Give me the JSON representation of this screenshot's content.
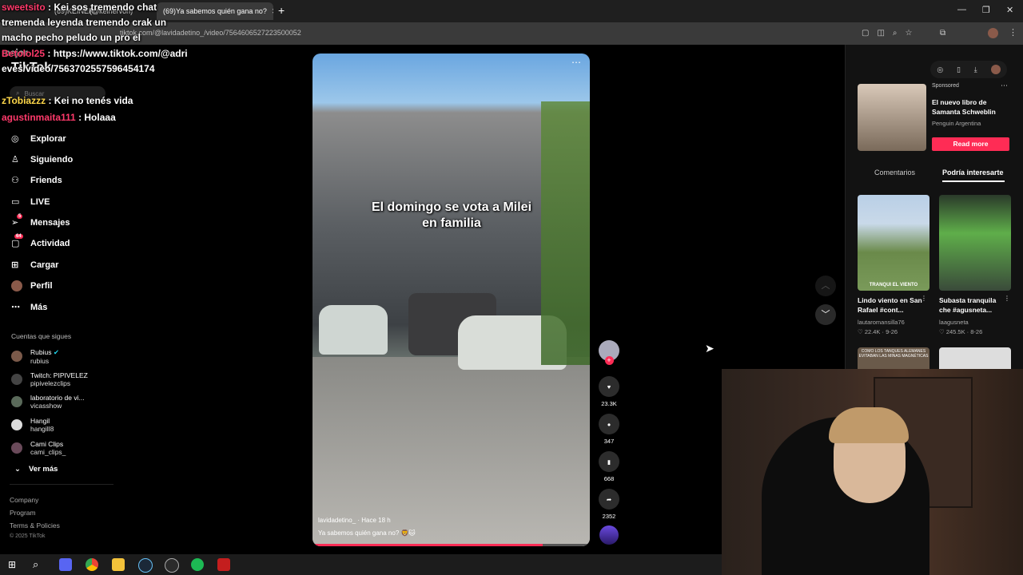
{
  "browser": {
    "tabs": [
      {
        "label": "(69)KEINER"
      },
      {
        "label": "(@keinervon)"
      },
      {
        "label": "(69)Ya sabemos quién gana no?",
        "active": true
      }
    ],
    "url": "tiktok.com/@lavidadetino_/video/7564606527223500052"
  },
  "chat": [
    {
      "user": "sweetsito",
      "msg": ": Kei sos tremendo chat tremenda leyenda tremendo crak un macho pecho peludo un pro el mejor"
    },
    {
      "user": "Betolol25",
      "msg": ": https://www.tiktok.com/@adrieves/video/7563702557596454174"
    },
    {
      "user": "zTobiazzz",
      "msg": ": Kei no tenés vida"
    },
    {
      "user": "agustinmaita111",
      "msg": ": Holaaa"
    }
  ],
  "nav": {
    "search_placeholder": "Buscar",
    "logo": "TikTok",
    "items": [
      {
        "label": "Explorar",
        "icon": "compass-icon"
      },
      {
        "label": "Siguiendo",
        "icon": "following-icon"
      },
      {
        "label": "Friends",
        "icon": "friends-icon"
      },
      {
        "label": "LIVE",
        "icon": "live-icon"
      },
      {
        "label": "Mensajes",
        "icon": "messages-icon",
        "badge": "5"
      },
      {
        "label": "Actividad",
        "icon": "activity-icon",
        "badge": "64"
      },
      {
        "label": "Cargar",
        "icon": "upload-icon"
      },
      {
        "label": "Perfil",
        "icon": "profile-icon"
      },
      {
        "label": "Más",
        "icon": "more-icon"
      }
    ],
    "following_title": "Cuentas que sigues",
    "following": [
      {
        "name": "Rubius",
        "handle": "rubius",
        "verified": true
      },
      {
        "name": "Twitch: PIPIVELEZ",
        "handle": "pipivelezclips"
      },
      {
        "name": "laboratorio de vi...",
        "handle": "vicasshow"
      },
      {
        "name": "Hangil",
        "handle": "hangill8"
      },
      {
        "name": "Cami Clips",
        "handle": "cami_clips_"
      }
    ],
    "see_more": "Ver más",
    "footer": [
      "Company",
      "Program",
      "Terms & Policies"
    ],
    "copyright": "© 2025 TikTok"
  },
  "video": {
    "caption": "El domingo se vota a Milei en familia",
    "author": "lavidadetino_",
    "time": "· Hace 18 h",
    "description": "Ya sabemos quién gana no? 🦁🐱",
    "likes": "23.3K",
    "comments": "347",
    "saves": "668",
    "shares": "2352",
    "progress": 0.83
  },
  "ad": {
    "sponsored": "Sponsored",
    "title": "El nuevo libro de Samanta Schweblin",
    "advertiser": "Penguin Argentina",
    "cta": "Read more"
  },
  "right_tabs": [
    "Comentarios",
    "Podría interesarte"
  ],
  "suggested": [
    {
      "title": "Lindo viento en San Rafael #cont...",
      "author": "lautaromansilla76",
      "likes": "22.4K",
      "date": "9-26",
      "thumb_text": "TRANQUI EL VIENTO"
    },
    {
      "title": "Subasta tranquila che #agusneta...",
      "author": "laagusneta",
      "likes": "245.5K",
      "date": "8-26"
    },
    {
      "thumb_text": "COMO LOS TANQUES ALEMANES EVITABAN LAS MINAS MAGNÉTICAS"
    },
    {}
  ],
  "colors": {
    "accent": "#fe2c55",
    "chat_user": "#ff3a6b",
    "background": "#000000"
  }
}
